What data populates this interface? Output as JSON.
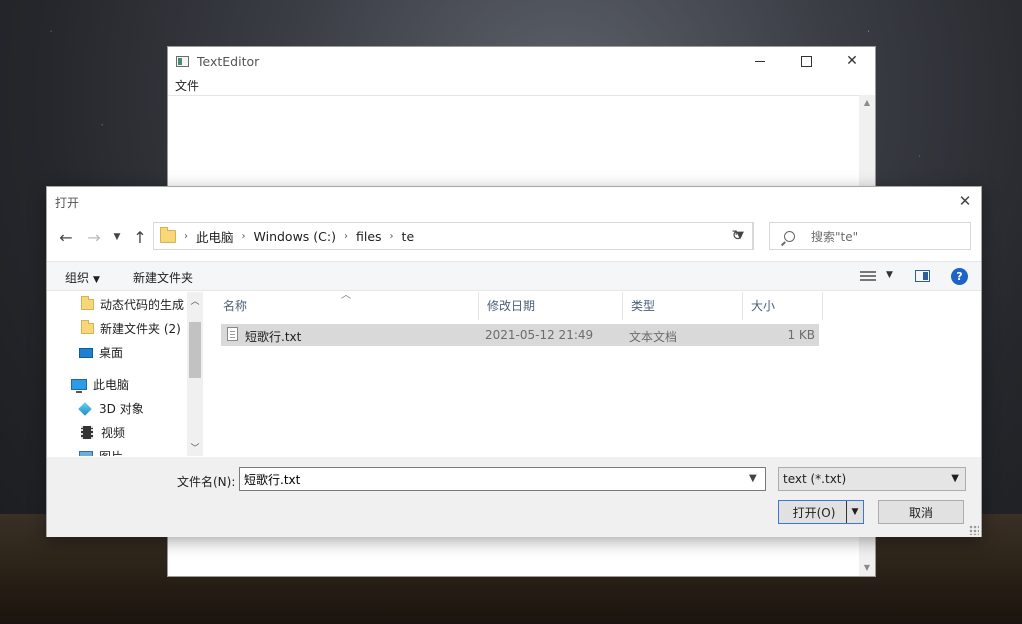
{
  "editor": {
    "title": "TextEditor",
    "menu": {
      "file": "文件"
    }
  },
  "dialog": {
    "title": "打开",
    "breadcrumb": [
      "此电脑",
      "Windows (C:)",
      "files",
      "te"
    ],
    "search_placeholder": "搜索\"te\"",
    "toolbar": {
      "organize": "组织",
      "new_folder": "新建文件夹"
    },
    "tree": [
      {
        "label": "动态代码的生成",
        "icon": "folder-icon"
      },
      {
        "label": "新建文件夹 (2)",
        "icon": "folder-icon"
      },
      {
        "label": "桌面",
        "icon": "desktop-icon"
      },
      {
        "label": "此电脑",
        "icon": "computer-icon"
      },
      {
        "label": "3D 对象",
        "icon": "3d-objects-icon"
      },
      {
        "label": "视频",
        "icon": "video-icon"
      },
      {
        "label": "图片",
        "icon": "pictures-icon"
      }
    ],
    "columns": {
      "name": "名称",
      "modified": "修改日期",
      "type": "类型",
      "size": "大小"
    },
    "files": [
      {
        "name": "短歌行.txt",
        "modified": "2021-05-12 21:49",
        "type": "文本文档",
        "size": "1 KB"
      }
    ],
    "filename_label": "文件名(N):",
    "filename_value": "短歌行.txt",
    "filter_value": "text (*.txt)",
    "open_label": "打开(O)",
    "cancel_label": "取消"
  }
}
